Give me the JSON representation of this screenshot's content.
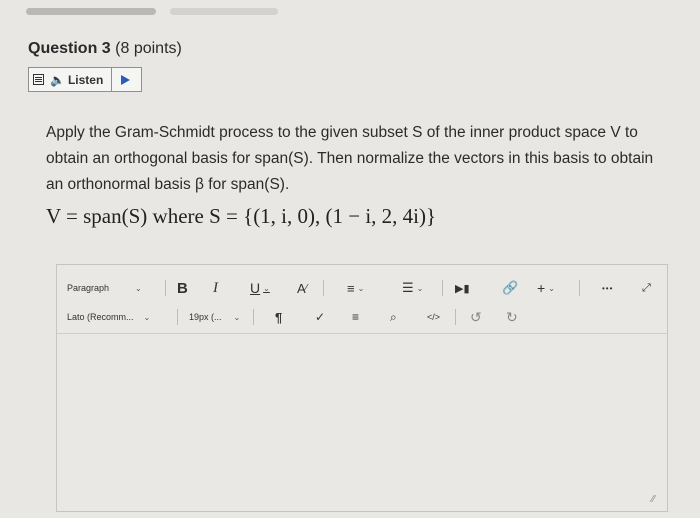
{
  "question": {
    "number": "Question 3",
    "points": "(8 points)"
  },
  "listen": {
    "label": "Listen"
  },
  "prompt": "Apply the Gram-Schmidt process to the given subset S of the inner product space V to obtain an orthogonal basis for span(S). Then normalize the vectors in this basis to obtain an orthonormal basis β for span(S).",
  "math": "V = span(S)  where  S = {(1, i, 0), (1 − i, 2, 4i)}",
  "toolbar": {
    "paragraph": "Paragraph",
    "bold": "B",
    "italic": "I",
    "underline": "U",
    "font": "Lato (Recomm...",
    "size": "19px (...",
    "html": "</>",
    "more": "•••",
    "insert": "+"
  }
}
